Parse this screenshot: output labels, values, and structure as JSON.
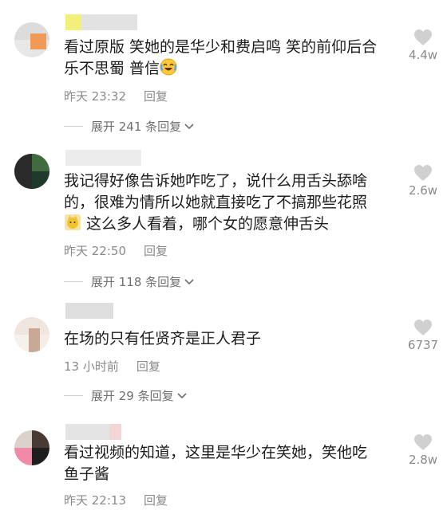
{
  "comments": [
    {
      "text_lines": [
        "看过原版 笑她的是华少和费启鸣 笑的前仰后合",
        "乐不思蜀 普信"
      ],
      "emoji_name": "laughing-crying-emoji",
      "time": "昨天 23:32",
      "reply": "回复",
      "likes": "4.4w",
      "expand": "展开 241 条回复"
    },
    {
      "text_lines": [
        "我记得好像告诉她咋吃了，说什么用舌头舔啥",
        "的，很难为情所以她就直接吃了不搞那些花照",
        "这么多人看着，哪个女的愿意伸舌头"
      ],
      "emoji_name": "sticker-emoji",
      "time": "昨天 22:50",
      "reply": "回复",
      "likes": "2.6w",
      "expand": "展开 118 条回复"
    },
    {
      "text_lines": [
        "在场的只有任贤齐是正人君子"
      ],
      "time": "13 小时前",
      "reply": "回复",
      "likes": "6737",
      "expand": "展开 29 条回复"
    },
    {
      "text_lines": [
        "看过视频的知道，这里是华少在笑她，笑他吃",
        "鱼子酱"
      ],
      "time": "昨天 22:13",
      "reply": "回复",
      "likes": "2.8w"
    }
  ],
  "colors": {
    "text": "#1c1c1c",
    "meta": "#8a8a8a",
    "heart": "#cccccc"
  }
}
